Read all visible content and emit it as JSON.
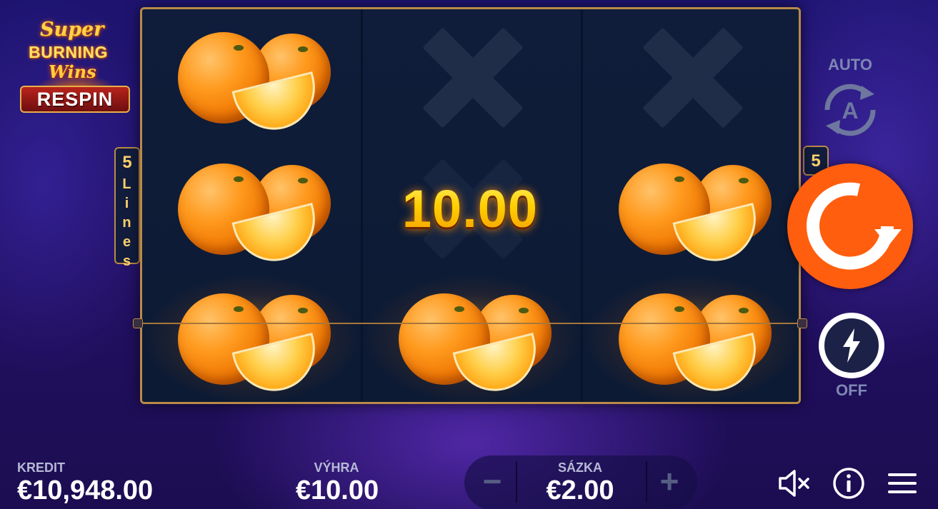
{
  "logo": {
    "line1": "Super",
    "line2": "BURNING",
    "line3": "Wins",
    "line4": "RESPIN"
  },
  "lines": {
    "count_left": "5",
    "word_letters": [
      "L",
      "i",
      "n",
      "e",
      "s"
    ],
    "count_right": "5"
  },
  "reels": [
    [
      "orange",
      "orange",
      "orange"
    ],
    [
      "x",
      "x",
      "orange"
    ],
    [
      "x",
      "orange",
      "orange"
    ]
  ],
  "win_overlay": "10.00",
  "controls": {
    "auto_label": "AUTO",
    "auto_icon_letter": "A",
    "turbo_label": "OFF",
    "spin_color": "#ff5e0e"
  },
  "bottom": {
    "credit_label": "KREDIT",
    "credit_value": "€10,948.00",
    "win_label": "VÝHRA",
    "win_value": "€10.00",
    "bet_label": "SÁZKA",
    "bet_value": "€2.00",
    "minus": "−",
    "plus": "+"
  },
  "colors": {
    "frame": "#b98a48",
    "win_gold": "#ffd21a",
    "accent": "#ff5e0e"
  }
}
